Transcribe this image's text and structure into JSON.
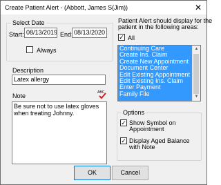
{
  "window": {
    "title": "Create Patient Alert - (Abbott, James S(Jim))",
    "close_glyph": "✕"
  },
  "select_date": {
    "group_title": "Select Date",
    "start_label": "Start:",
    "start_value": "08/13/2019",
    "end_label": "End:",
    "end_value": "08/13/2020",
    "always_label": "Always",
    "always_checked": false
  },
  "description": {
    "label": "Description",
    "value": "Latex allergy"
  },
  "note": {
    "label": "Note",
    "value": "Be sure not to use latex gloves when treating Johnny.",
    "spellcheck_icon": "spellcheck-icon"
  },
  "areas": {
    "header_line1": "Patient Alert should display for the",
    "header_line2": "patient in the following areas:",
    "all_label": "All",
    "all_checked": true,
    "items": [
      "Continuing Care",
      "Create Ins. Claim",
      "Create New Appointment",
      "Document Center",
      "Edit Existing Appointment",
      "Edit Existing Ins. Claim",
      "Enter Payment",
      "Family File"
    ]
  },
  "options": {
    "group_title": "Options",
    "show_symbol_line1": "Show Symbol on",
    "show_symbol_line2": "Appointment",
    "show_symbol_checked": true,
    "display_aged_line1": "Display Aged Balance",
    "display_aged_line2": "with Note",
    "display_aged_checked": true
  },
  "buttons": {
    "ok_label": "OK",
    "cancel_label": "Cancel"
  },
  "colors": {
    "selection": "#3399ff",
    "default_button_border": "#0078d7"
  }
}
